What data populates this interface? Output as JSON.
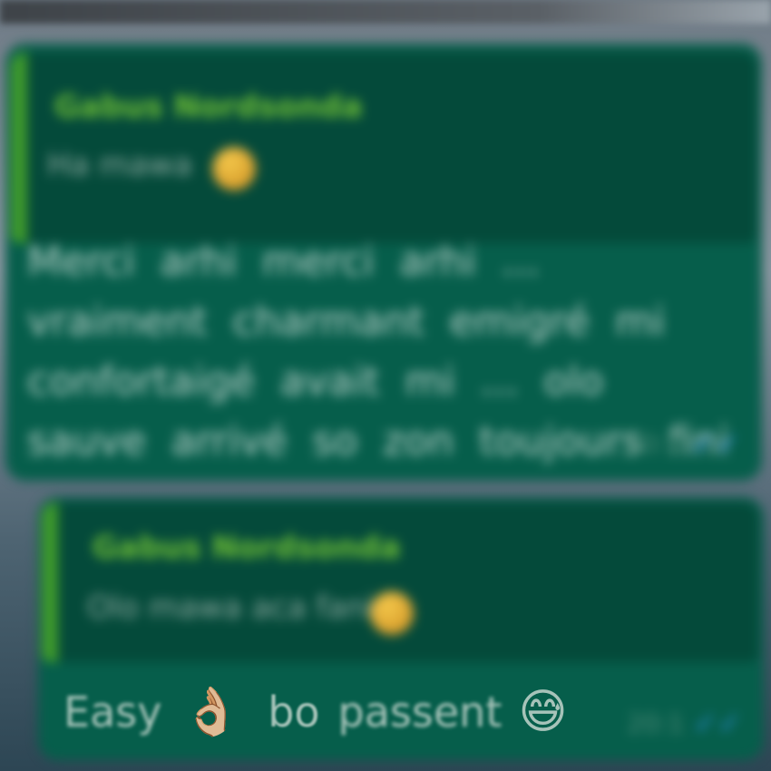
{
  "message1": {
    "quote": {
      "author": "Gabus Nordsonda",
      "text": "Ha mawa"
    },
    "body": "Merci arhi merci arhi ... vraiment charmant emigré mi confortaigé avait mi ... olo sauve arrivé so zon toujours fini",
    "time": "20:1",
    "ticks": "✓✓"
  },
  "message2": {
    "quote": {
      "author": "Gabus Nordsonda",
      "text": "Olo mawa aca fanie"
    },
    "text_word1": "Easy",
    "emoji1": "👌🏼",
    "text_word2": "bo",
    "text_word3": "passent",
    "emoji2": "😅",
    "time": "20:1",
    "ticks": "✓✓"
  }
}
